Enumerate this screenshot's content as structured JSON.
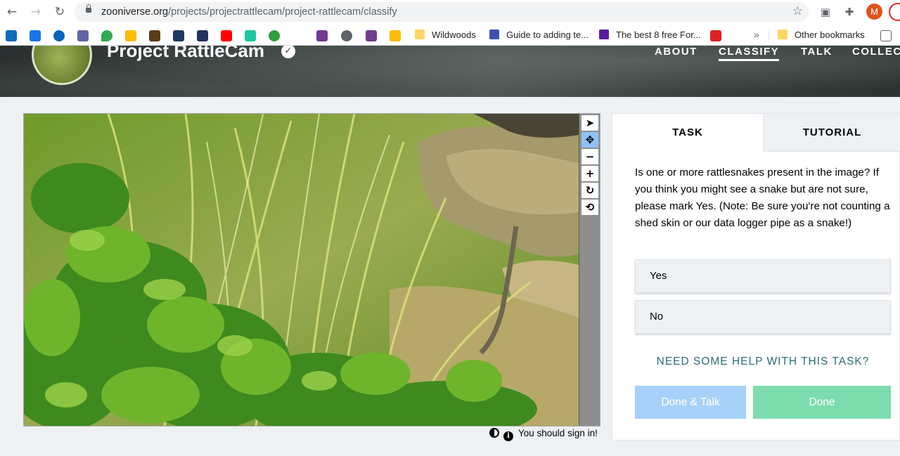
{
  "browser": {
    "url_host": "zooniverse.org",
    "url_path": "/projects/projectrattlecam/project-rattlecam/classify",
    "profile_initial": "M",
    "bookmarks": [
      {
        "label": "Wildwoods",
        "color": "#fdd663"
      },
      {
        "label": "Guide to adding te...",
        "color": "#3f51b5"
      },
      {
        "label": "The best 8 free For...",
        "color": "#5b1a9b"
      },
      {
        "label": "",
        "color": "#e02020"
      }
    ],
    "other_bookmarks": "Other bookmarks",
    "overflow": "»"
  },
  "site": {
    "project_title": "Project RattleCam",
    "nav": {
      "about": "ABOUT",
      "classify": "CLASSIFY",
      "talk": "TALK",
      "collect": "COLLEC"
    }
  },
  "viewer": {
    "tools": [
      "pointer-icon",
      "pan-icon",
      "zoom-out-icon",
      "zoom-in-icon",
      "rotate-icon",
      "reset-icon"
    ],
    "active_tool": "pan-icon",
    "sign_in_notice": "You should sign in!"
  },
  "task": {
    "tabs": {
      "task": "TASK",
      "tutorial": "TUTORIAL"
    },
    "question": "Is one or more rattlesnakes present in the image? If you think you might see a snake but are not sure, please mark Yes. (Note: Be sure you're not counting a shed skin or our data logger pipe as a snake!)",
    "answers": [
      "Yes",
      "No"
    ],
    "help": "NEED SOME HELP WITH THIS TASK?",
    "done_talk": "Done & Talk",
    "done": "Done"
  },
  "colors": {
    "active_tool": "#8fc2f5",
    "done_talk": "#a7d1f8",
    "done": "#7ddcad",
    "help_link": "#2b6c74"
  }
}
